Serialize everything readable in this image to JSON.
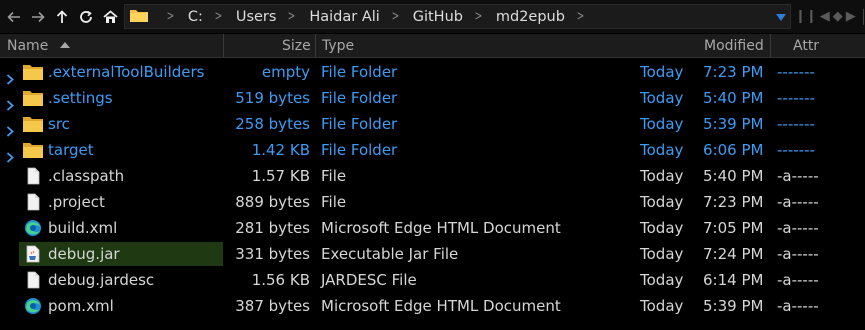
{
  "toolbar": {
    "back_icon": "arrow-left-icon",
    "forward_icon": "arrow-right-icon",
    "up_icon": "arrow-up-icon",
    "refresh_icon": "refresh-icon",
    "home_icon": "home-icon"
  },
  "address_bar": {
    "crumbs": [
      "C:",
      "Users",
      "Haidar Ali",
      "GitHub",
      "md2epub"
    ]
  },
  "columns": {
    "name": "Name",
    "size": "Size",
    "type": "Type",
    "modified": "Modified",
    "attr": "Attr"
  },
  "colors": {
    "folder_text": "#3d9cf5",
    "file_text": "#d6d6d6",
    "selection": "#1f3a12",
    "folder_icon": "#f2c24d"
  },
  "files": [
    {
      "name": ".externalToolBuilders",
      "size": "empty",
      "type": "File Folder",
      "day": "Today",
      "time": "7:23 PM",
      "attr": "-------",
      "kind": "folder",
      "icon": "folder-icon"
    },
    {
      "name": ".settings",
      "size": "519 bytes",
      "type": "File Folder",
      "day": "Today",
      "time": "5:40 PM",
      "attr": "-------",
      "kind": "folder",
      "icon": "folder-icon"
    },
    {
      "name": "src",
      "size": "258 bytes",
      "type": "File Folder",
      "day": "Today",
      "time": "5:39 PM",
      "attr": "-------",
      "kind": "folder",
      "icon": "folder-icon"
    },
    {
      "name": "target",
      "size": "1.42 KB",
      "type": "File Folder",
      "day": "Today",
      "time": "6:06 PM",
      "attr": "-------",
      "kind": "folder",
      "icon": "folder-icon"
    },
    {
      "name": ".classpath",
      "size": "1.57 KB",
      "type": "File",
      "day": "Today",
      "time": "5:40 PM",
      "attr": "-a-----",
      "kind": "file",
      "icon": "blank-file-icon"
    },
    {
      "name": ".project",
      "size": "889 bytes",
      "type": "File",
      "day": "Today",
      "time": "7:23 PM",
      "attr": "-a-----",
      "kind": "file",
      "icon": "blank-file-icon"
    },
    {
      "name": "build.xml",
      "size": "281 bytes",
      "type": "Microsoft Edge HTML Document",
      "day": "Today",
      "time": "7:05 PM",
      "attr": "-a-----",
      "kind": "file",
      "icon": "edge-icon"
    },
    {
      "name": "debug.jar",
      "size": "331 bytes",
      "type": "Executable Jar File",
      "day": "Today",
      "time": "7:24 PM",
      "attr": "-a-----",
      "kind": "file",
      "icon": "jar-file-icon",
      "selected": true
    },
    {
      "name": "debug.jardesc",
      "size": "1.56 KB",
      "type": "JARDESC File",
      "day": "Today",
      "time": "6:14 PM",
      "attr": "-a-----",
      "kind": "file",
      "icon": "blank-file-icon"
    },
    {
      "name": "pom.xml",
      "size": "387 bytes",
      "type": "Microsoft Edge HTML Document",
      "day": "Today",
      "time": "5:39 PM",
      "attr": "-a-----",
      "kind": "file",
      "icon": "edge-icon"
    }
  ]
}
